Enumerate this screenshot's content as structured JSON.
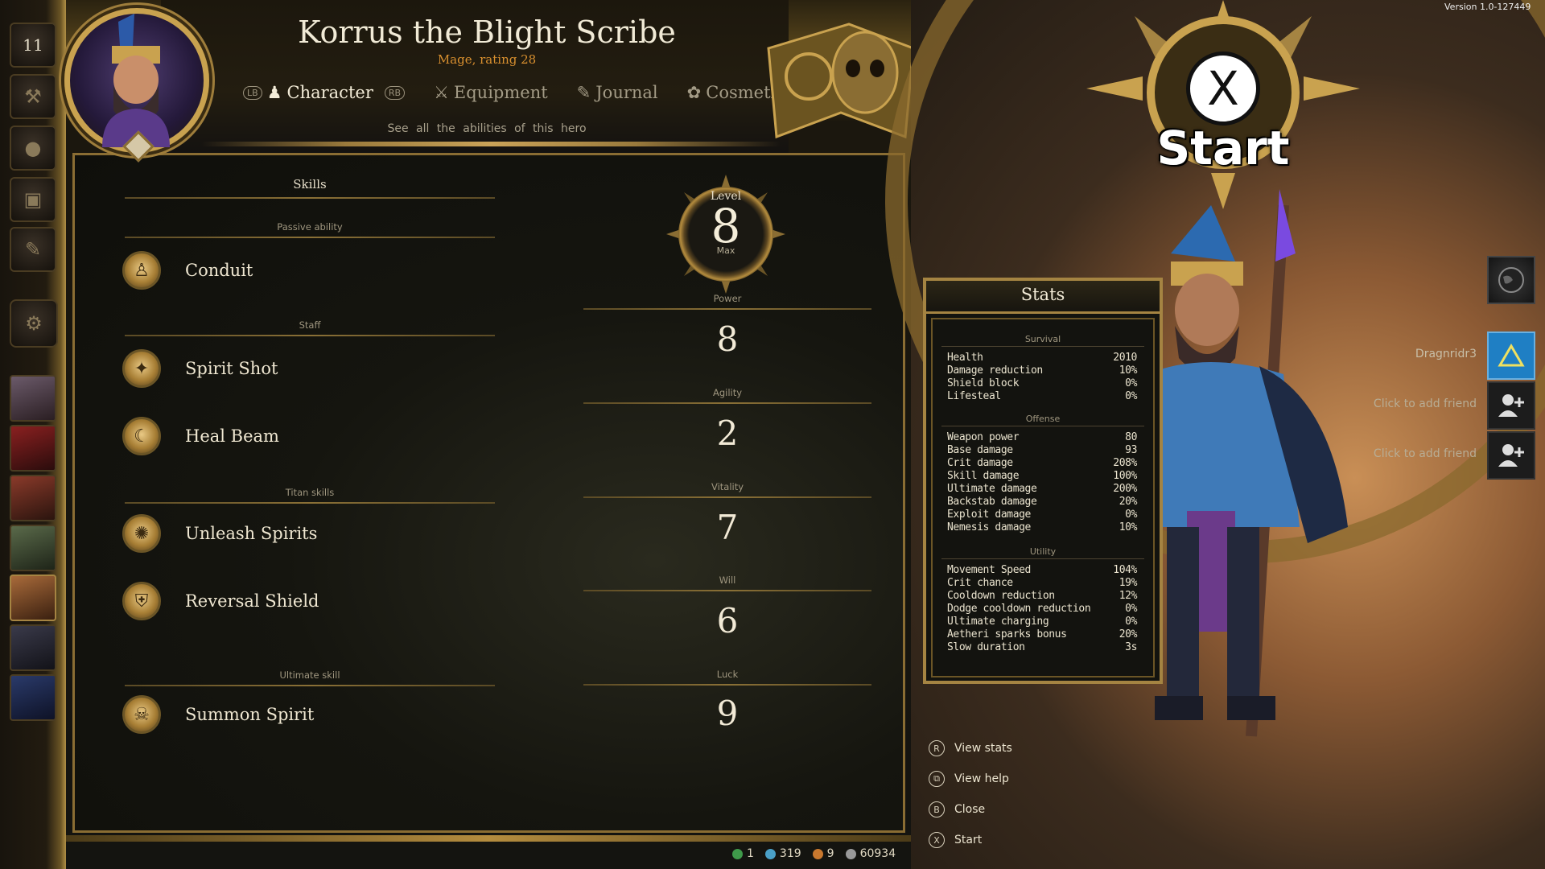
{
  "version": "Version 1.0-127449",
  "hero": {
    "name": "Korrus the Blight Scribe",
    "subtitle": "Mage, rating 28"
  },
  "tabs": {
    "lb": "LB",
    "rb": "RB",
    "items": [
      {
        "label": "Character",
        "icon": "character-icon",
        "active": true
      },
      {
        "label": "Equipment",
        "icon": "equipment-icon",
        "active": false
      },
      {
        "label": "Journal",
        "icon": "journal-icon",
        "active": false
      },
      {
        "label": "Cosmetics",
        "icon": "cosmetics-icon",
        "active": false
      }
    ],
    "description": "See all the abilities of this hero"
  },
  "left_rail": {
    "rank_number": "11",
    "buttons": [
      "rank-icon",
      "anvil-icon",
      "bag-icon",
      "chest-icon",
      "quill-icon",
      "settings-icon"
    ],
    "heroes": [
      "hero-portrait-1",
      "hero-portrait-2",
      "hero-portrait-3",
      "hero-portrait-4",
      "hero-portrait-5",
      "hero-portrait-6",
      "hero-portrait-7"
    ]
  },
  "skills": {
    "heading": "Skills",
    "groups": {
      "passive": "Passive ability",
      "staff": "Staff",
      "titan": "Titan skills",
      "ultimate": "Ultimate skill"
    },
    "items": {
      "conduit": "Conduit",
      "spirit_shot": "Spirit Shot",
      "heal_beam": "Heal Beam",
      "unleash_spirits": "Unleash Spirits",
      "reversal_shield": "Reversal Shield",
      "summon_spirit": "Summon Spirit"
    }
  },
  "level": {
    "label": "Level",
    "value": "8",
    "max": "Max"
  },
  "attributes": {
    "power": {
      "label": "Power",
      "value": "8"
    },
    "agility": {
      "label": "Agility",
      "value": "2"
    },
    "vitality": {
      "label": "Vitality",
      "value": "7"
    },
    "will": {
      "label": "Will",
      "value": "6"
    },
    "luck": {
      "label": "Luck",
      "value": "9"
    }
  },
  "stats": {
    "title": "Stats",
    "survival": {
      "label": "Survival",
      "rows": [
        {
          "name": "Health",
          "value": "2010"
        },
        {
          "name": "Damage reduction",
          "value": "10%"
        },
        {
          "name": "Shield block",
          "value": "0%"
        },
        {
          "name": "Lifesteal",
          "value": "0%"
        }
      ]
    },
    "offense": {
      "label": "Offense",
      "rows": [
        {
          "name": "Weapon power",
          "value": "80"
        },
        {
          "name": "Base damage",
          "value": "93"
        },
        {
          "name": "Crit damage",
          "value": "208%"
        },
        {
          "name": "Skill damage",
          "value": "100%"
        },
        {
          "name": "Ultimate damage",
          "value": "200%"
        },
        {
          "name": "Backstab damage",
          "value": "20%"
        },
        {
          "name": "Exploit damage",
          "value": "0%"
        },
        {
          "name": "Nemesis damage",
          "value": "10%"
        }
      ]
    },
    "utility": {
      "label": "Utility",
      "rows": [
        {
          "name": "Movement Speed",
          "value": "104%"
        },
        {
          "name": "Crit chance",
          "value": "19%"
        },
        {
          "name": "Cooldown reduction",
          "value": "12%"
        },
        {
          "name": "Dodge cooldown reduction",
          "value": "0%"
        },
        {
          "name": "Ultimate charging",
          "value": "0%"
        },
        {
          "name": "Aetheri sparks bonus",
          "value": "20%"
        },
        {
          "name": "Slow duration",
          "value": "3s"
        }
      ]
    }
  },
  "controls": [
    {
      "button": "R",
      "label": "View stats"
    },
    {
      "button": "⧉",
      "label": "View help"
    },
    {
      "button": "B",
      "label": "Close"
    },
    {
      "button": "X",
      "label": "Start"
    }
  ],
  "start_badge": {
    "button": "X",
    "label": "Start"
  },
  "currency": [
    {
      "value": "1",
      "color": "#3f9a4a"
    },
    {
      "value": "319",
      "color": "#4aa0c8"
    },
    {
      "value": "9",
      "color": "#c9782e"
    },
    {
      "value": "60934",
      "color": "#9a9a9a"
    }
  ],
  "social": {
    "player": "Dragnridr3",
    "add_friend_1": "Click to add friend",
    "add_friend_2": "Click to add friend"
  },
  "colors": {
    "gold": "#b48c3e",
    "accent_blue": "#2f8fd0"
  }
}
